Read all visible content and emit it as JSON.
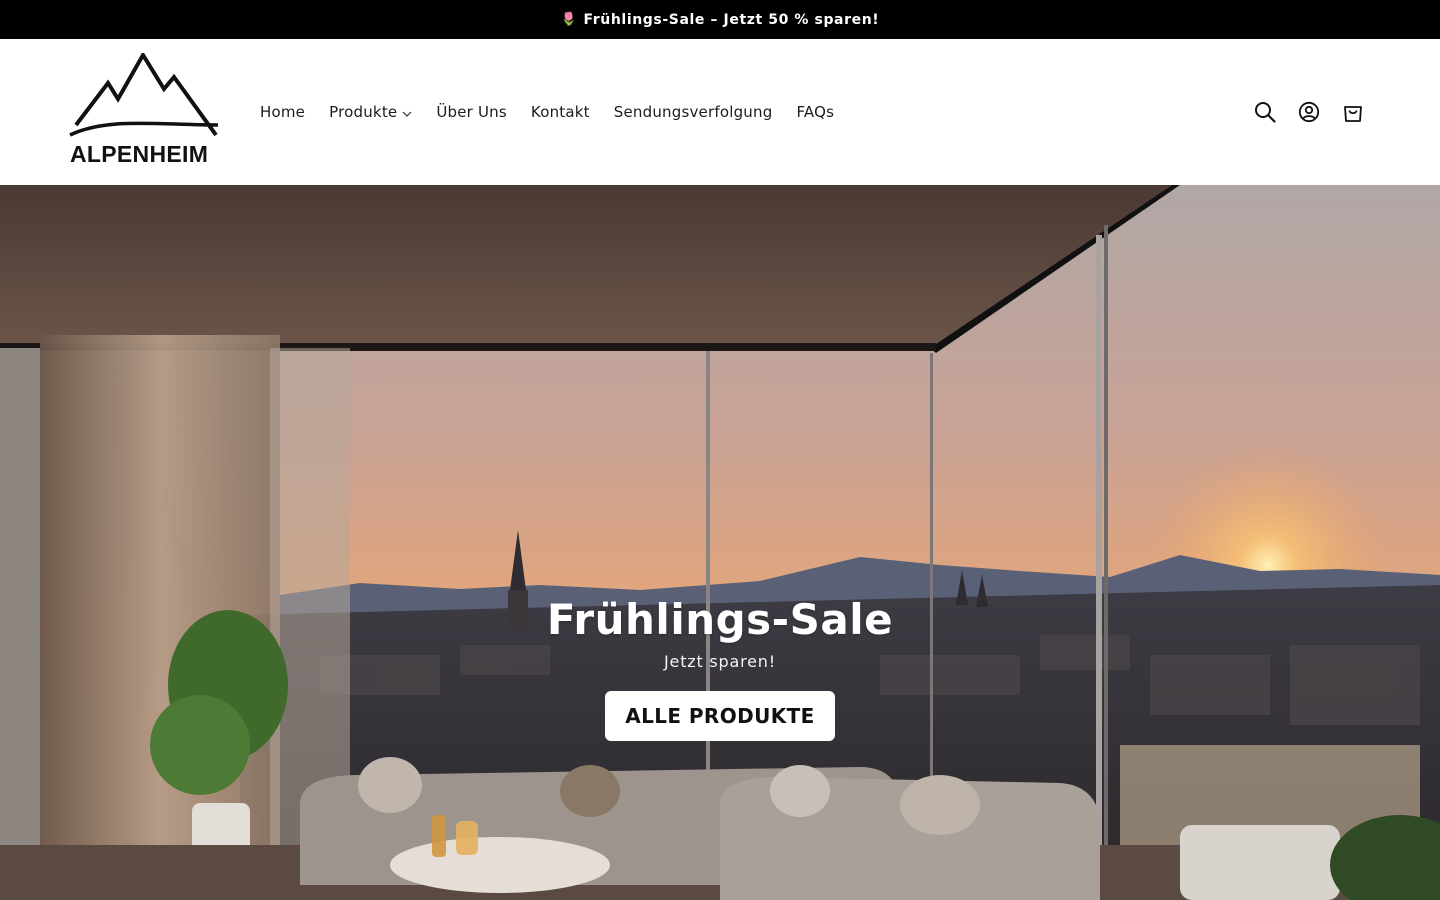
{
  "announcement": {
    "emoji": "🌷",
    "text": "Frühlings-Sale – Jetzt 50 % sparen!"
  },
  "brand": {
    "name": "ALPENHEIM"
  },
  "nav": {
    "items": [
      {
        "label": "Home"
      },
      {
        "label": "Produkte",
        "has_dropdown": true
      },
      {
        "label": "Über Uns"
      },
      {
        "label": "Kontakt"
      },
      {
        "label": "Sendungsverfolgung"
      },
      {
        "label": "FAQs"
      }
    ]
  },
  "header_icons": [
    "search-icon",
    "account-icon",
    "cart-icon"
  ],
  "hero": {
    "title": "Frühlings-Sale",
    "subtitle": "Jetzt sparen!",
    "button_label": "ALLE PRODUKTE"
  },
  "colors": {
    "announcement_bg": "#000000",
    "announcement_text": "#ffffff",
    "header_bg": "#ffffff",
    "button_bg": "#ffffff",
    "button_text": "#111111"
  }
}
